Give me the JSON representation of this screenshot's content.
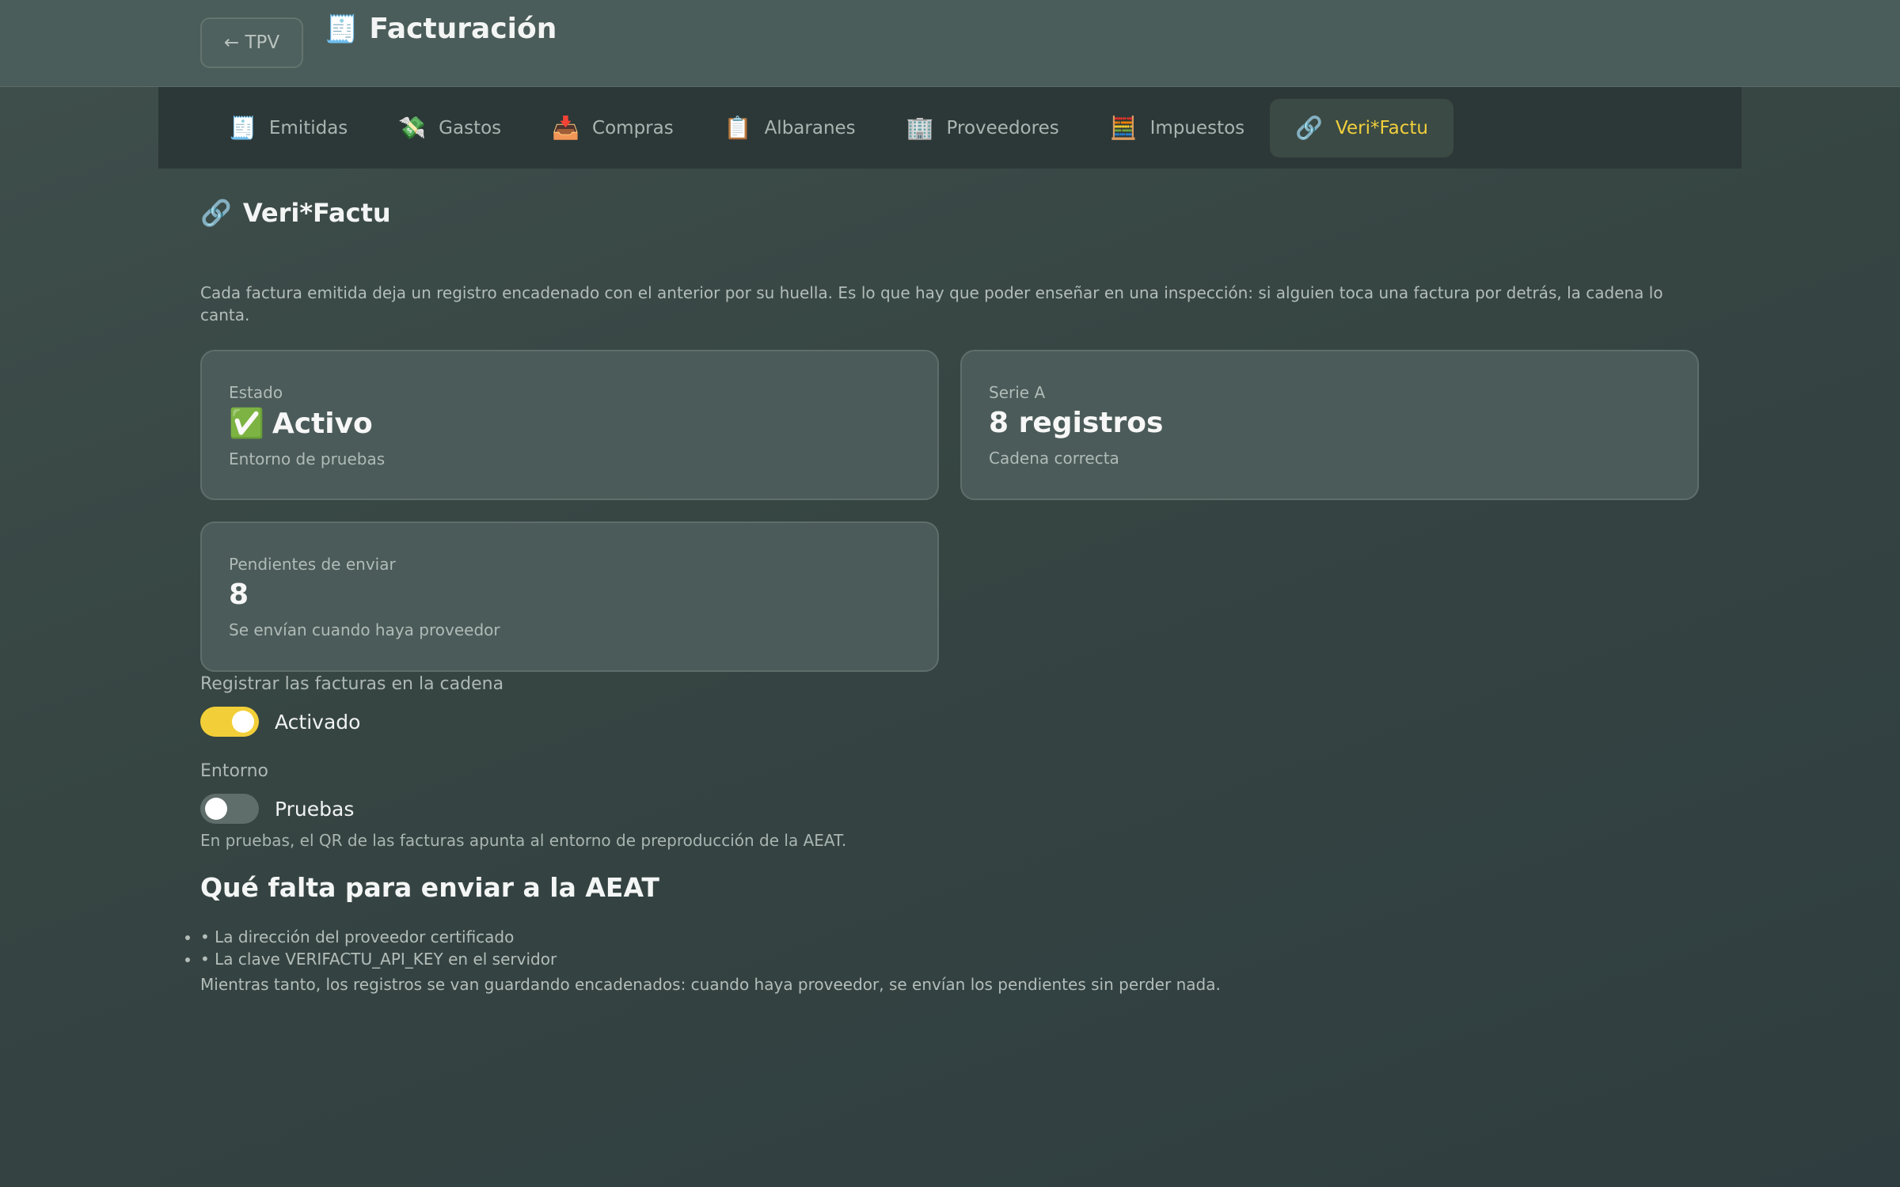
{
  "header": {
    "back_label": "← TPV",
    "title_icon": "🧾",
    "title": "Facturación"
  },
  "tabs": [
    {
      "icon": "🧾",
      "label": "Emitidas",
      "active": false
    },
    {
      "icon": "💸",
      "label": "Gastos",
      "active": false
    },
    {
      "icon": "📥",
      "label": "Compras",
      "active": false
    },
    {
      "icon": "📋",
      "label": "Albaranes",
      "active": false
    },
    {
      "icon": "🏢",
      "label": "Proveedores",
      "active": false
    },
    {
      "icon": "🧮",
      "label": "Impuestos",
      "active": false
    },
    {
      "icon": "🔗",
      "label": "Veri*Factu",
      "active": true
    }
  ],
  "section": {
    "icon": "🔗",
    "title": "Veri*Factu",
    "intro": "Cada factura emitida deja un registro encadenado con el anterior por su huella. Es lo que hay que poder enseñar en una inspección: si alguien toca una factura por detrás, la cadena lo canta."
  },
  "cards": {
    "estado": {
      "label": "Estado",
      "icon": "✅",
      "value": "Activo",
      "hint": "Entorno de pruebas"
    },
    "serie": {
      "label": "Serie A",
      "value": "8 registros",
      "hint": "Cadena correcta"
    },
    "pendientes": {
      "label": "Pendientes de enviar",
      "value": "8",
      "hint": "Se envían cuando haya proveedor"
    }
  },
  "settings": {
    "register": {
      "label": "Registrar las facturas en la cadena",
      "state_text": "Activado",
      "on": true
    },
    "environment": {
      "label": "Entorno",
      "state_text": "Pruebas",
      "on": false,
      "note": "En pruebas, el QR de las facturas apunta al entorno de preproducción de la AEAT."
    }
  },
  "missing": {
    "title": "Qué falta para enviar a la AEAT",
    "items": [
      "• La dirección del proveedor certificado",
      "• La clave VERIFACTU_API_KEY en el servidor"
    ],
    "note": "Mientras tanto, los registros se van guardando encadenados: cuando haya proveedor, se envían los pendientes sin perder nada."
  },
  "colors": {
    "accent": "#f2cf38",
    "background": "#364542"
  }
}
